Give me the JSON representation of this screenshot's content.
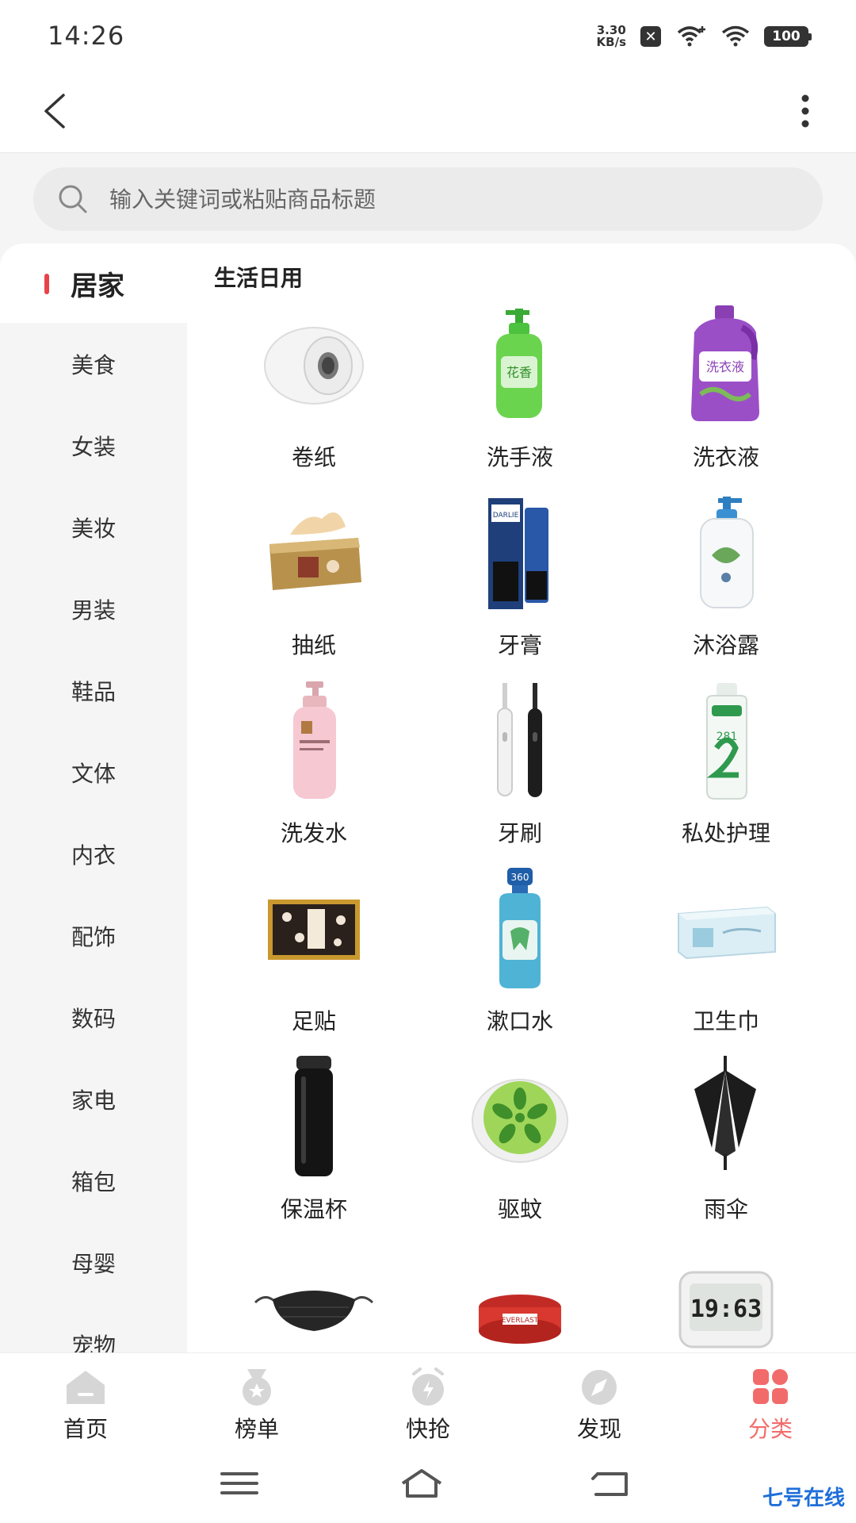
{
  "status_bar": {
    "time": "14:26",
    "net_speed_value": "3.30",
    "net_speed_unit": "KB/s",
    "battery": "100"
  },
  "search": {
    "placeholder": "输入关键词或粘贴商品标题"
  },
  "sidebar": {
    "items": [
      {
        "label": "居家",
        "active": true
      },
      {
        "label": "美食"
      },
      {
        "label": "女装"
      },
      {
        "label": "美妆"
      },
      {
        "label": "男装"
      },
      {
        "label": "鞋品"
      },
      {
        "label": "文体"
      },
      {
        "label": "内衣"
      },
      {
        "label": "配饰"
      },
      {
        "label": "数码"
      },
      {
        "label": "家电"
      },
      {
        "label": "箱包"
      },
      {
        "label": "母婴"
      },
      {
        "label": "宠物"
      }
    ]
  },
  "section": {
    "title": "生活日用"
  },
  "products": [
    {
      "label": "卷纸",
      "icon": "toilet-paper-roll"
    },
    {
      "label": "洗手液",
      "icon": "hand-soap-bottle"
    },
    {
      "label": "洗衣液",
      "icon": "laundry-detergent-bottle"
    },
    {
      "label": "抽纸",
      "icon": "tissue-box"
    },
    {
      "label": "牙膏",
      "icon": "toothpaste-box"
    },
    {
      "label": "沐浴露",
      "icon": "body-wash-bottle"
    },
    {
      "label": "洗发水",
      "icon": "shampoo-bottle"
    },
    {
      "label": "牙刷",
      "icon": "electric-toothbrush"
    },
    {
      "label": "私处护理",
      "icon": "care-wash-bottle"
    },
    {
      "label": "足贴",
      "icon": "foot-patch-box"
    },
    {
      "label": "漱口水",
      "icon": "mouthwash-bottle"
    },
    {
      "label": "卫生巾",
      "icon": "sanitary-pad-pack"
    },
    {
      "label": "保温杯",
      "icon": "thermos-cup"
    },
    {
      "label": "驱蚊",
      "icon": "mosquito-repellent"
    },
    {
      "label": "雨伞",
      "icon": "umbrella"
    },
    {
      "label": "",
      "icon": "face-mask"
    },
    {
      "label": "",
      "icon": "hand-wrap-roll"
    },
    {
      "label": "",
      "icon": "digital-thermometer"
    }
  ],
  "product_image_text": {
    "hand_soap_brand": "花香",
    "laundry_brand": "洗衣液",
    "toothpaste_brand": "DARLIE",
    "wash_number": "281",
    "mouthwash_badge": "360",
    "wrap_brand": "EVERLAST",
    "thermometer_reading": "19:63"
  },
  "bottom_nav": {
    "items": [
      {
        "label": "首页",
        "icon": "home-icon"
      },
      {
        "label": "榜单",
        "icon": "medal-icon"
      },
      {
        "label": "快抢",
        "icon": "alarm-icon"
      },
      {
        "label": "发现",
        "icon": "compass-icon"
      },
      {
        "label": "分类",
        "icon": "category-grid-icon",
        "active": true
      }
    ]
  },
  "watermark": "七号在线",
  "colors": {
    "accent": "#e8434a",
    "active_tab": "#f26b6b",
    "inactive_icon": "#d6d6d6"
  }
}
